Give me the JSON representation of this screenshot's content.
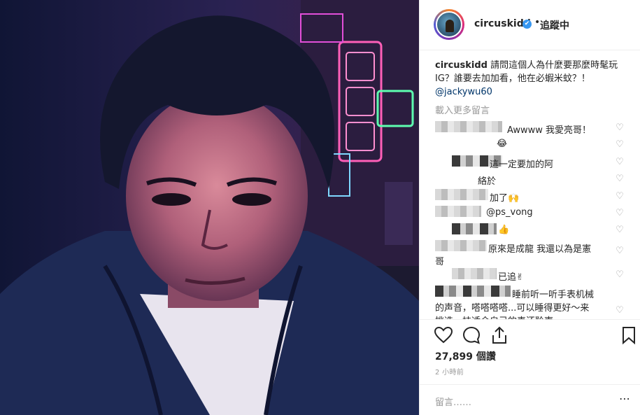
{
  "post": {
    "username": "circuskidd",
    "follow_status": "追蹤中",
    "separator": "•",
    "verified_mark": "✔",
    "caption_text": "請問這個人為什麼要那麼時髦玩IG？誰要去加加看，他在必蝦米蚊？！",
    "caption_mention": "@jackywu60",
    "load_more": "載入更多留言"
  },
  "comments": [
    {
      "text": "Awwww 我愛亮哥！"
    },
    {
      "text": "😂"
    },
    {
      "text": "這一定要加的阿"
    },
    {
      "text": "絡於"
    },
    {
      "text": "加了🙌"
    },
    {
      "text": "@ps_vong"
    },
    {
      "text": "👍"
    },
    {
      "text": "原來是成龍 我還以為是憲"
    },
    {
      "text": "哥"
    },
    {
      "text": "已追✌"
    },
    {
      "text": "睡前听一听手表机械"
    },
    {
      "text": "的声音，嗒嗒嗒嗒...可以睡得更好～来"
    },
    {
      "text": "挑选一枝适合自己的表还聆声～"
    }
  ],
  "icons": {
    "heart": "heart-icon",
    "comment": "comment-icon",
    "share": "share-icon",
    "save": "bookmark-icon",
    "more": "more-icon"
  },
  "stats": {
    "views": "27,899 個讚",
    "time": "2 小時前"
  },
  "add_comment": {
    "placeholder": "留言……",
    "more": "⋯"
  },
  "colors": {
    "link": "#003569",
    "verified": "#3897f0",
    "muted": "#999999"
  }
}
